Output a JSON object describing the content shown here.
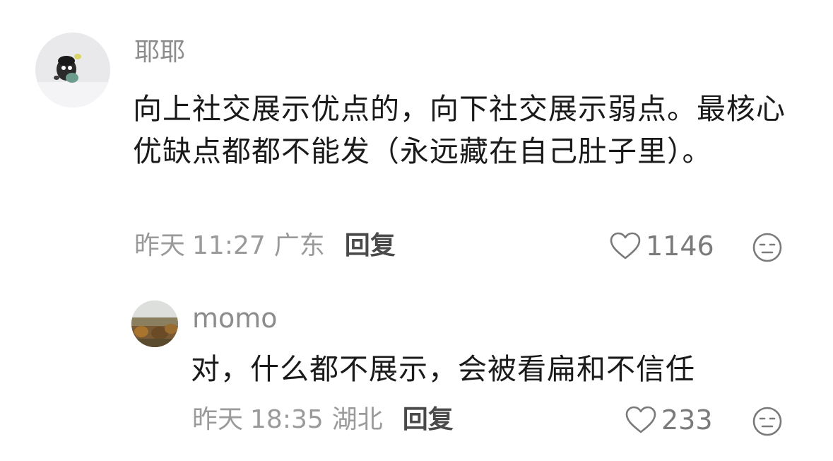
{
  "comments": [
    {
      "username": "耶耶",
      "content": "向上社交展示优点的，向下社交展示弱点。最核心优缺点都都不能发（永远藏在自己肚子里）。",
      "date": "昨天",
      "time": "11:27",
      "location": "广东",
      "reply_label": "回复",
      "likes": "1146"
    },
    {
      "username": "momo",
      "content": "对，什么都不展示，会被看扁和不信任",
      "date": "昨天",
      "time": "18:35",
      "location": "湖北",
      "reply_label": "回复",
      "likes": "233"
    }
  ],
  "icons": {
    "like": "heart-outline-icon",
    "dislike": "meh-face-icon"
  },
  "colors": {
    "username": "#8c8c8c",
    "content": "#1a1a1a",
    "meta": "#9a9a9a",
    "reply": "#4a4a4a"
  }
}
